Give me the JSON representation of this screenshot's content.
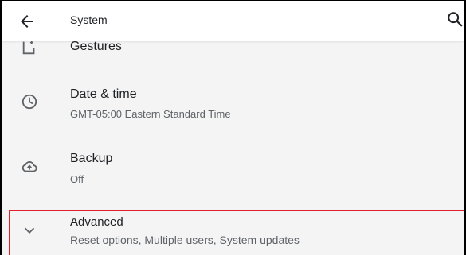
{
  "appbar": {
    "title": "System",
    "back_icon": "arrow-back-icon",
    "search_icon": "search-icon"
  },
  "settings": [
    {
      "icon": "gestures-icon",
      "title": "Gestures",
      "subtitle": ""
    },
    {
      "icon": "clock-icon",
      "title": "Date & time",
      "subtitle": "GMT-05:00 Eastern Standard Time"
    },
    {
      "icon": "cloud-upload-icon",
      "title": "Backup",
      "subtitle": "Off"
    },
    {
      "icon": "chevron-down-icon",
      "title": "Advanced",
      "subtitle": "Reset options, Multiple users, System updates"
    }
  ],
  "colors": {
    "background": "#f4f4f4",
    "appbar": "#ffffff",
    "primary_text": "#202124",
    "secondary_text": "#5f6368",
    "icon": "#5f6368",
    "highlight_border": "#e2202c"
  }
}
